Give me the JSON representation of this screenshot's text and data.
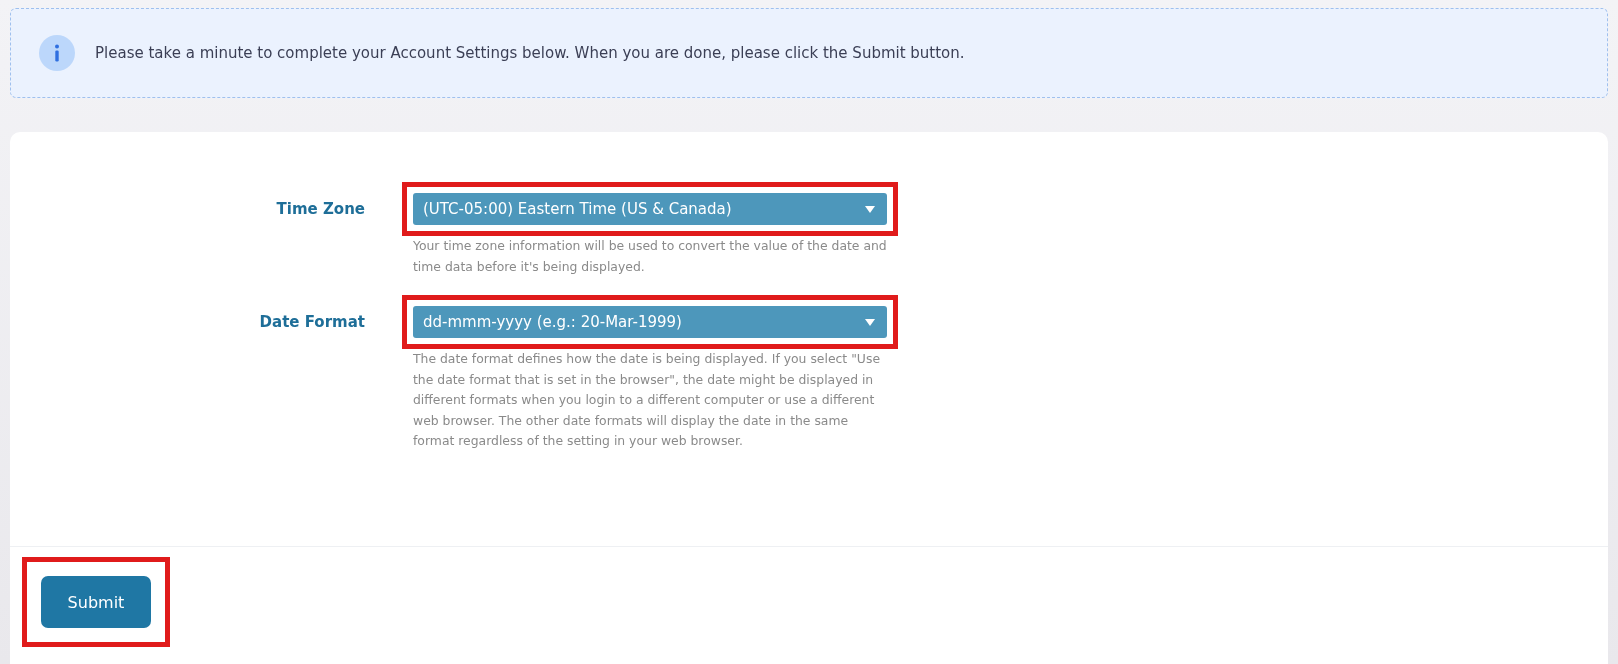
{
  "notice": {
    "text": "Please take a minute to complete your Account Settings below. When you are done, please click the Submit button."
  },
  "fields": [
    {
      "label": "Time Zone",
      "value": "(UTC-05:00) Eastern Time (US & Canada)",
      "help": "Your time zone information will be used to convert the value of the date and time data before it's being displayed.",
      "highlighted": true
    },
    {
      "label": "Date Format",
      "value": "dd-mmm-yyyy (e.g.: 20-Mar-1999)",
      "help": "The date format defines how the date is being displayed. If you select \"Use the date format that is set in the browser\", the date might be displayed in different formats when you login to a different computer or use a different web browser. The other date formats will display the date in the same format regardless of the setting in your web browser.",
      "highlighted": true
    }
  ],
  "submit": {
    "label": "Submit",
    "highlighted": true
  }
}
